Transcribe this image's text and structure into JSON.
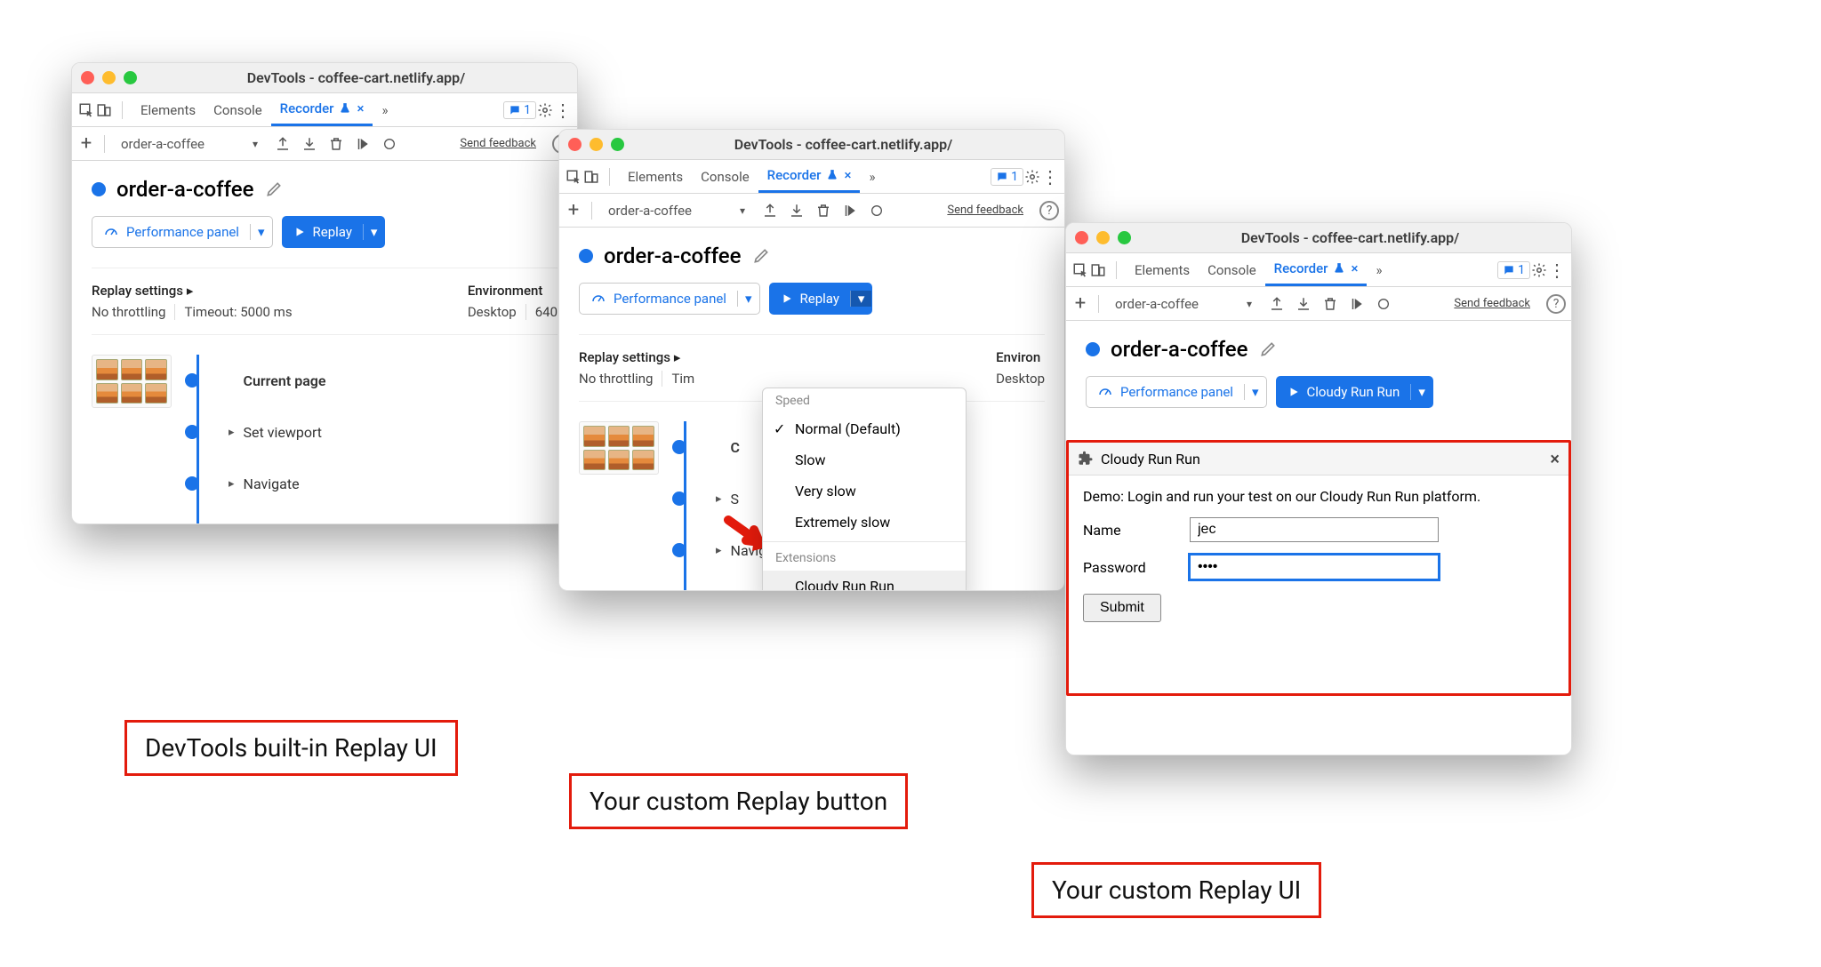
{
  "window_title": "DevTools - coffee-cart.netlify.app/",
  "tabs": {
    "elements": "Elements",
    "console": "Console",
    "recorder": "Recorder",
    "msg_count": "1"
  },
  "toolbar": {
    "recording": "order-a-coffee",
    "feedback": "Send feedback"
  },
  "recording": {
    "title": "order-a-coffee",
    "perf_btn": "Performance panel",
    "replay_btn": "Replay",
    "cloudy_btn": "Cloudy Run Run"
  },
  "settings": {
    "replay_hdr": "Replay settings",
    "throttling": "No throttling",
    "timeout": "Timeout: 5000 ms",
    "env_hdr": "Environment",
    "desktop": "Desktop",
    "res": "640"
  },
  "timeline": {
    "current": "Current page",
    "viewport": "Set viewport",
    "navigate": "Navigate"
  },
  "dropdown": {
    "speed_label": "Speed",
    "items": [
      "Normal (Default)",
      "Slow",
      "Very slow",
      "Extremely slow"
    ],
    "ext_label": "Extensions",
    "ext_item": "Cloudy Run Run"
  },
  "ext_panel": {
    "title": "Cloudy Run Run",
    "desc": "Demo: Login and run your test on our Cloudy Run Run platform.",
    "name_label": "Name",
    "name_value": "jec",
    "pwd_label": "Password",
    "pwd_value": "••••",
    "submit": "Submit"
  },
  "captions": {
    "c1": "DevTools built-in Replay UI",
    "c2": "Your custom Replay button",
    "c3": "Your custom Replay UI"
  }
}
